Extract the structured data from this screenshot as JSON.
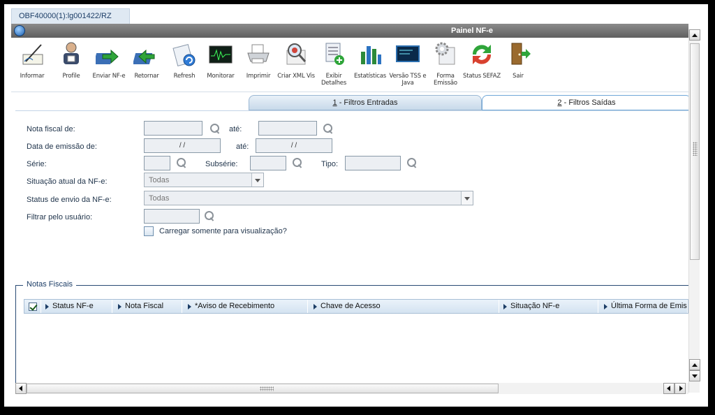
{
  "doc_tab": "OBF40000(1):lg001422/RZ",
  "window_title": "Painel NF-e",
  "toolbar": [
    {
      "label": "Informar",
      "icon": "pen-paper-icon"
    },
    {
      "label": "Profile",
      "icon": "user-profile-icon"
    },
    {
      "label": "Enviar NF-e",
      "icon": "send-arrow-icon"
    },
    {
      "label": "Retornar",
      "icon": "return-arrow-icon"
    },
    {
      "label": "Refresh",
      "icon": "refresh-icon"
    },
    {
      "label": "Monitorar",
      "icon": "monitor-icon"
    },
    {
      "label": "Imprimir",
      "icon": "printer-icon"
    },
    {
      "label": "Criar XML Vis",
      "icon": "magnifier-icon"
    },
    {
      "label": "Exibir Detalhes",
      "icon": "details-icon"
    },
    {
      "label": "Estatísticas",
      "icon": "bar-chart-icon"
    },
    {
      "label": "Versão TSS e Java",
      "icon": "screen-icon"
    },
    {
      "label": "Forma Emissão",
      "icon": "gear-doc-icon"
    },
    {
      "label": "Status SEFAZ",
      "icon": "recycle-icon"
    },
    {
      "label": "Sair",
      "icon": "exit-door-icon"
    }
  ],
  "filter_tabs": {
    "entradas": {
      "key": "1",
      "label": " - Filtros Entradas"
    },
    "saidas": {
      "key": "2",
      "label": " - Filtros Saídas"
    }
  },
  "filters": {
    "nota_fiscal_label": "Nota fiscal de:",
    "ate": "até:",
    "data_emissao_label": "Data de emissão de:",
    "date_placeholder": "/ /",
    "serie_label": "Série:",
    "subserie_label": "Subsérie:",
    "tipo_label": "Tipo:",
    "situacao_label": "Situação atual da NF-e:",
    "situacao_value": "Todas",
    "status_envio_label": "Status de envio da NF-e:",
    "status_envio_value": "Todas",
    "usuario_label": "Filtrar pelo usuário:",
    "carregar_label": "Carregar somente para visualização?"
  },
  "grid": {
    "legend": "Notas Fiscais",
    "columns": [
      "Status NF-e",
      "Nota Fiscal",
      "*Aviso de Recebimento",
      "Chave de Acesso",
      "Situação NF-e",
      "Última Forma de Emis"
    ]
  },
  "colors": {
    "accent": "#1c3d66",
    "title_bar": "#6e6e6e",
    "tab_active": "#c8d9ea"
  }
}
